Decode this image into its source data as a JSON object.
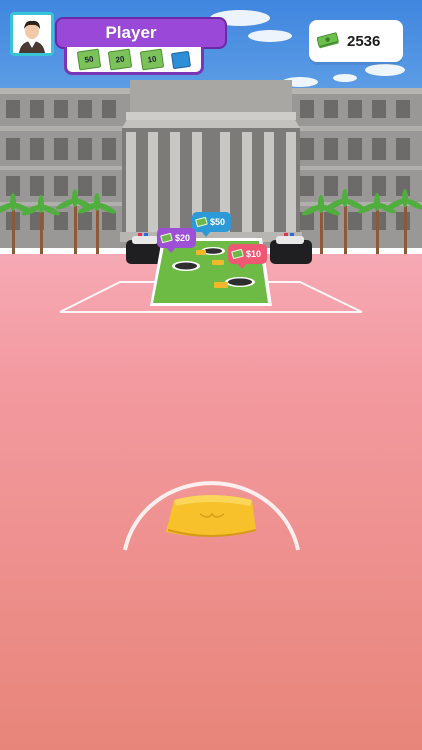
{
  "player": {
    "name": "Player"
  },
  "chips": [
    {
      "value": "50"
    },
    {
      "value": "20"
    },
    {
      "value": "10"
    },
    {
      "value": ""
    }
  ],
  "money": {
    "amount": "2536"
  },
  "targets": [
    {
      "label": "$50"
    },
    {
      "label": "$20"
    },
    {
      "label": "$10"
    }
  ],
  "colors": {
    "sky": "#4f8edf",
    "ground": "#ec8a84",
    "name_bar": "#9a48d8",
    "board": "#6dbb45",
    "bag": "#f6c12b"
  },
  "icons": [
    "avatar-icon",
    "cash-icon",
    "chip-icon",
    "sandbag-icon",
    "palm-tree-icon",
    "police-car-icon"
  ]
}
